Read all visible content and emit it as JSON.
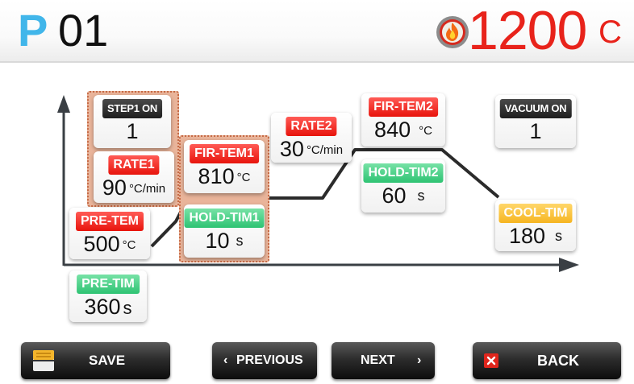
{
  "header": {
    "program_prefix": "P",
    "program_number": "01",
    "temperature": "1200",
    "temperature_unit": "C"
  },
  "cards": {
    "step1": {
      "label": "STEP1 ON",
      "value": "1",
      "unit": ""
    },
    "rate1": {
      "label": "RATE1",
      "value": "90",
      "unit": "°C/min"
    },
    "pre_tem": {
      "label": "PRE-TEM",
      "value": "500",
      "unit": "°C"
    },
    "pre_tim": {
      "label": "PRE-TIM",
      "value": "360",
      "unit": "s"
    },
    "fir_tem1": {
      "label": "FIR-TEM1",
      "value": "810",
      "unit": "°C"
    },
    "hold_tim1": {
      "label": "HOLD-TIM1",
      "value": "10",
      "unit": "s"
    },
    "rate2": {
      "label": "RATE2",
      "value": "30",
      "unit": "°C/min"
    },
    "fir_tem2": {
      "label": "FIR-TEM2",
      "value": "840",
      "unit": "°C"
    },
    "hold_tim2": {
      "label": "HOLD-TIM2",
      "value": "60",
      "unit": "s"
    },
    "vacuum": {
      "label": "VACUUM ON",
      "value": "1",
      "unit": ""
    },
    "cool_tim": {
      "label": "COOL-TIM",
      "value": "180",
      "unit": "s"
    }
  },
  "buttons": {
    "save": "SAVE",
    "previous": "PREVIOUS",
    "next": "NEXT",
    "back": "BACK"
  },
  "icons": {
    "header": "flame-icon",
    "save": "save-icon",
    "back": "back-x-icon",
    "previous": "chevron-left-icon",
    "next": "chevron-right-icon"
  },
  "colors": {
    "program_prefix": "#41b6ea",
    "temperature": "#e8231b",
    "label_red": "#e8140c",
    "label_green": "#2ec373",
    "label_dark": "#1e1e1e",
    "label_yellow": "#f6b521",
    "group_highlight": "#e9b49a"
  }
}
